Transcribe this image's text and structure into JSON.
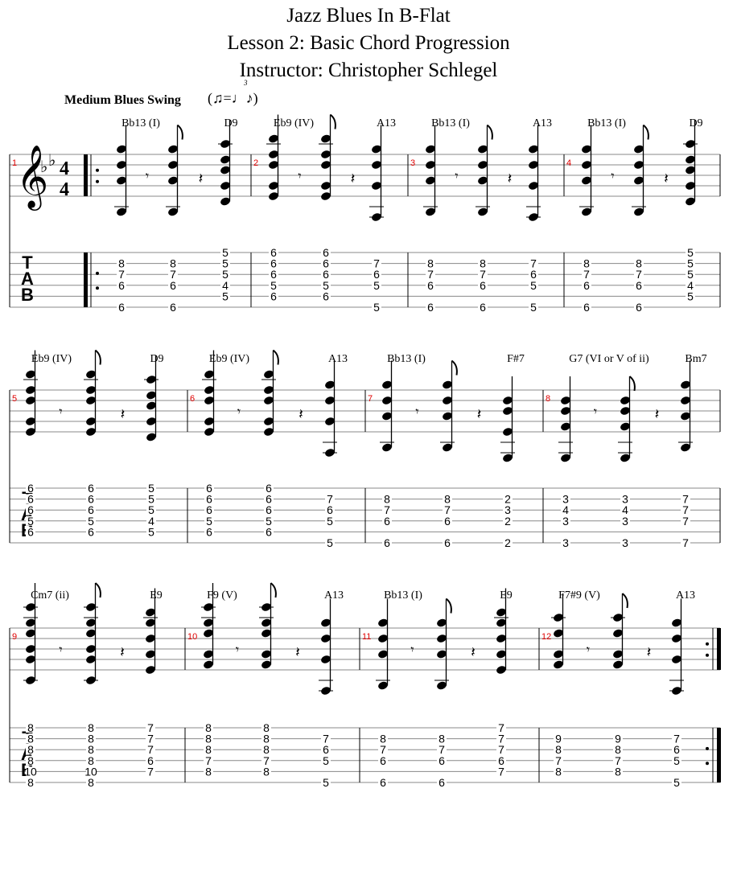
{
  "header": {
    "title": "Jazz Blues In B-Flat",
    "subtitle": "Lesson 2:  Basic Chord Progression",
    "instructor": "Instructor:  Christopher Schlegel"
  },
  "tempo": {
    "marking": "Medium Blues Swing",
    "swing_symbol": "(♫=♩♪)",
    "triplet_label": "3"
  },
  "tab_label": [
    "T",
    "A",
    "B"
  ],
  "key_signature": "Bb",
  "time_signature": "4/4",
  "colors": {
    "measure_number": "#e00000",
    "ink": "#000000",
    "staff_line": "#888888"
  },
  "measures": [
    {
      "number": "1",
      "chords": [
        "Bb13 (I)",
        "D9"
      ],
      "tab": [
        [
          null,
          8,
          7,
          6,
          null,
          6
        ],
        [
          null,
          8,
          7,
          6,
          null,
          6
        ],
        [
          5,
          5,
          5,
          4,
          5,
          null
        ]
      ]
    },
    {
      "number": "2",
      "chords": [
        "Eb9 (IV)",
        "A13"
      ],
      "tab": [
        [
          6,
          6,
          6,
          5,
          6,
          null
        ],
        [
          6,
          6,
          6,
          5,
          6,
          null
        ],
        [
          null,
          7,
          6,
          5,
          null,
          5
        ]
      ]
    },
    {
      "number": "3",
      "chords": [
        "Bb13 (I)",
        "A13"
      ],
      "tab": [
        [
          null,
          8,
          7,
          6,
          null,
          6
        ],
        [
          null,
          8,
          7,
          6,
          null,
          6
        ],
        [
          null,
          7,
          6,
          5,
          null,
          5
        ]
      ]
    },
    {
      "number": "4",
      "chords": [
        "Bb13 (I)",
        "D9"
      ],
      "tab": [
        [
          null,
          8,
          7,
          6,
          null,
          6
        ],
        [
          null,
          8,
          7,
          6,
          null,
          6
        ],
        [
          5,
          5,
          5,
          4,
          5,
          null
        ]
      ]
    },
    {
      "number": "5",
      "chords": [
        "Eb9 (IV)",
        "D9"
      ],
      "tab": [
        [
          6,
          6,
          6,
          5,
          6,
          null
        ],
        [
          6,
          6,
          6,
          5,
          6,
          null
        ],
        [
          5,
          5,
          5,
          4,
          5,
          null
        ]
      ]
    },
    {
      "number": "6",
      "chords": [
        "Eb9 (IV)",
        "A13"
      ],
      "tab": [
        [
          6,
          6,
          6,
          5,
          6,
          null
        ],
        [
          6,
          6,
          6,
          5,
          6,
          null
        ],
        [
          null,
          7,
          6,
          5,
          null,
          5
        ]
      ]
    },
    {
      "number": "7",
      "chords": [
        "Bb13 (I)",
        "F#7"
      ],
      "tab": [
        [
          null,
          8,
          7,
          6,
          null,
          6
        ],
        [
          null,
          8,
          7,
          6,
          null,
          6
        ],
        [
          null,
          2,
          3,
          2,
          null,
          2
        ]
      ]
    },
    {
      "number": "8",
      "chords": [
        "G7 (VI or V of ii)",
        "Bm7"
      ],
      "tab": [
        [
          null,
          3,
          4,
          3,
          null,
          3
        ],
        [
          null,
          3,
          4,
          3,
          null,
          3
        ],
        [
          null,
          7,
          7,
          7,
          null,
          7
        ]
      ]
    },
    {
      "number": "9",
      "chords": [
        "Cm7 (ii)",
        "E9"
      ],
      "tab": [
        [
          8,
          8,
          8,
          8,
          10,
          8
        ],
        [
          8,
          8,
          8,
          8,
          10,
          8
        ],
        [
          7,
          7,
          7,
          6,
          7,
          null
        ]
      ]
    },
    {
      "number": "10",
      "chords": [
        "F9 (V)",
        "A13"
      ],
      "tab": [
        [
          8,
          8,
          8,
          7,
          8,
          null
        ],
        [
          8,
          8,
          8,
          7,
          8,
          null
        ],
        [
          null,
          7,
          6,
          5,
          null,
          5
        ]
      ]
    },
    {
      "number": "11",
      "chords": [
        "Bb13 (I)",
        "E9"
      ],
      "tab": [
        [
          null,
          8,
          7,
          6,
          null,
          6
        ],
        [
          null,
          8,
          7,
          6,
          null,
          6
        ],
        [
          7,
          7,
          7,
          6,
          7,
          null
        ]
      ]
    },
    {
      "number": "12",
      "chords": [
        "F7#9 (V)",
        "A13"
      ],
      "tab": [
        [
          null,
          9,
          8,
          7,
          8,
          null
        ],
        [
          null,
          9,
          8,
          7,
          8,
          null
        ],
        [
          null,
          7,
          6,
          5,
          null,
          5
        ]
      ]
    }
  ]
}
